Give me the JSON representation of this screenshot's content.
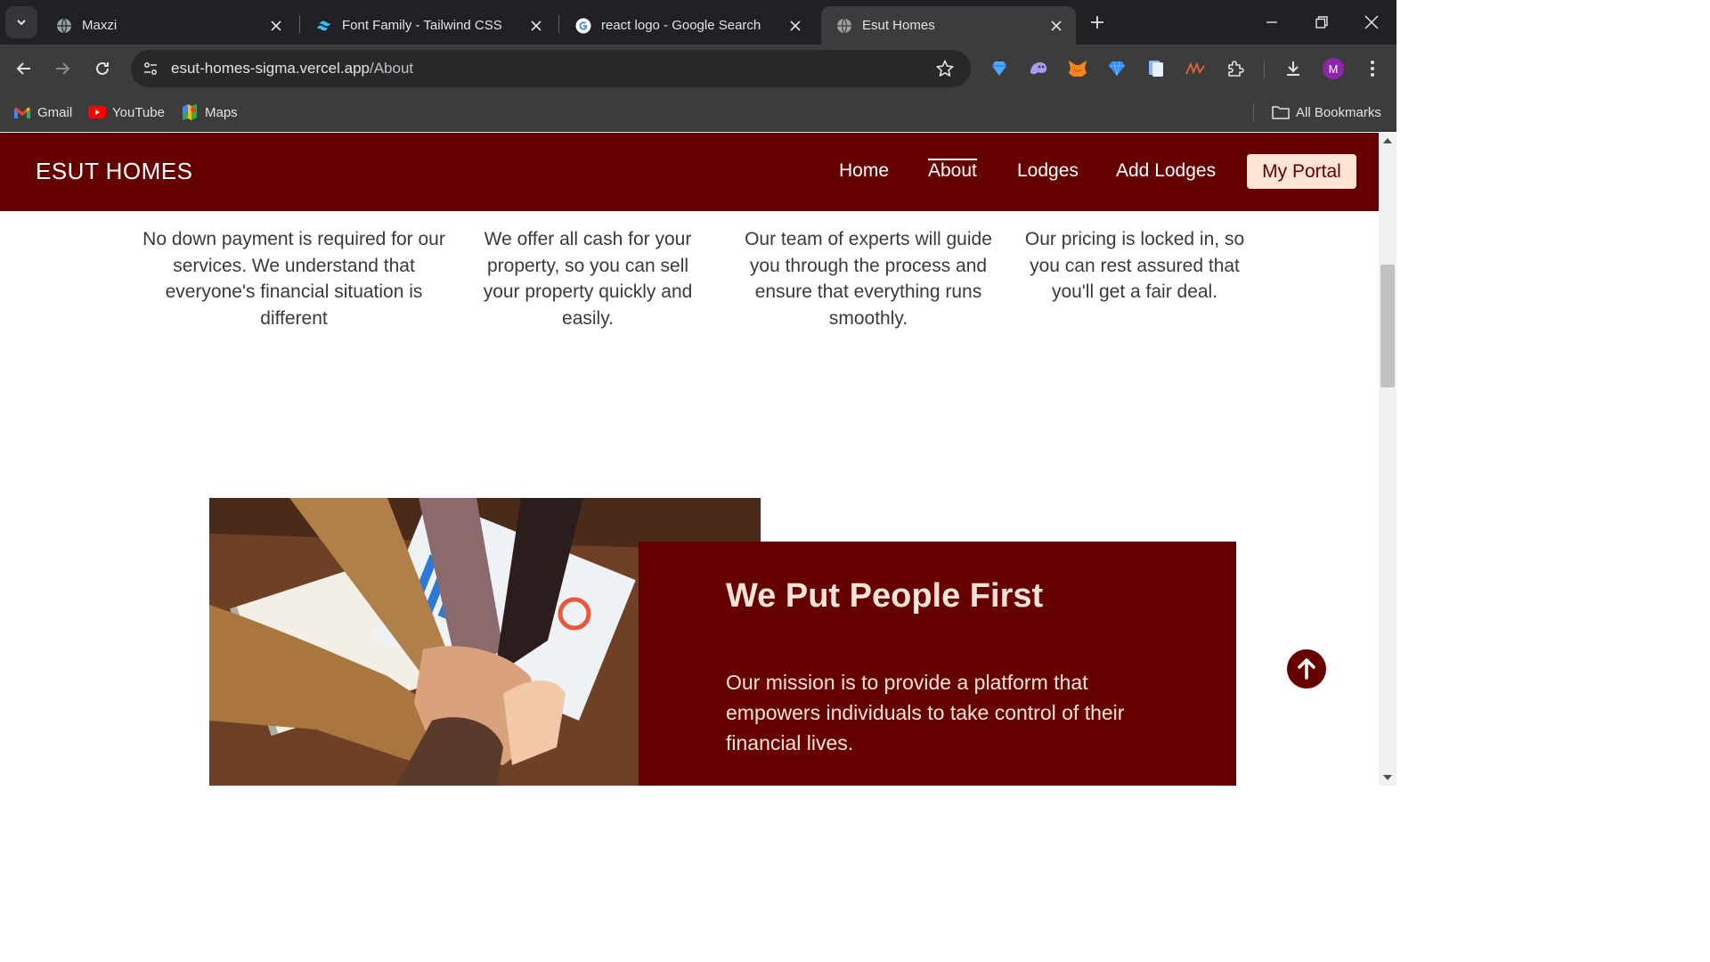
{
  "browser": {
    "tabs": [
      {
        "title": "Maxzi",
        "favicon": "globe-icon"
      },
      {
        "title": "Font Family - Tailwind CSS",
        "favicon": "tailwind-icon"
      },
      {
        "title": "react logo - Google Search",
        "favicon": "google-icon"
      },
      {
        "title": "Esut Homes",
        "favicon": "globe-icon",
        "active": true
      }
    ],
    "url_host": "esut-homes-sigma.vercel.app",
    "url_path": "/About",
    "avatar_letter": "M",
    "bookmarks": [
      {
        "label": "Gmail",
        "icon": "gmail-icon"
      },
      {
        "label": "YouTube",
        "icon": "youtube-icon"
      },
      {
        "label": "Maps",
        "icon": "maps-icon"
      }
    ],
    "all_bookmarks": "All Bookmarks"
  },
  "site": {
    "brand": "ESUT HOMES",
    "nav": {
      "home": "Home",
      "about": "About",
      "lodges": "Lodges",
      "add_lodges": "Add Lodges",
      "portal": "My Portal"
    },
    "features": [
      "No down payment is required for our services. We understand that everyone's financial situation is different",
      "We offer all cash for your property, so you can sell your property quickly and easily.",
      "Our team of experts will guide you through the process and ensure that everything runs smoothly.",
      "Our pricing is locked in, so you can rest assured that you'll get a fair deal."
    ],
    "mission": {
      "title": "We Put People First",
      "text": "Our mission is to provide a platform that empowers individuals to take control of their financial lives."
    }
  },
  "colors": {
    "brand": "#660000",
    "accent": "#fde4d6"
  }
}
